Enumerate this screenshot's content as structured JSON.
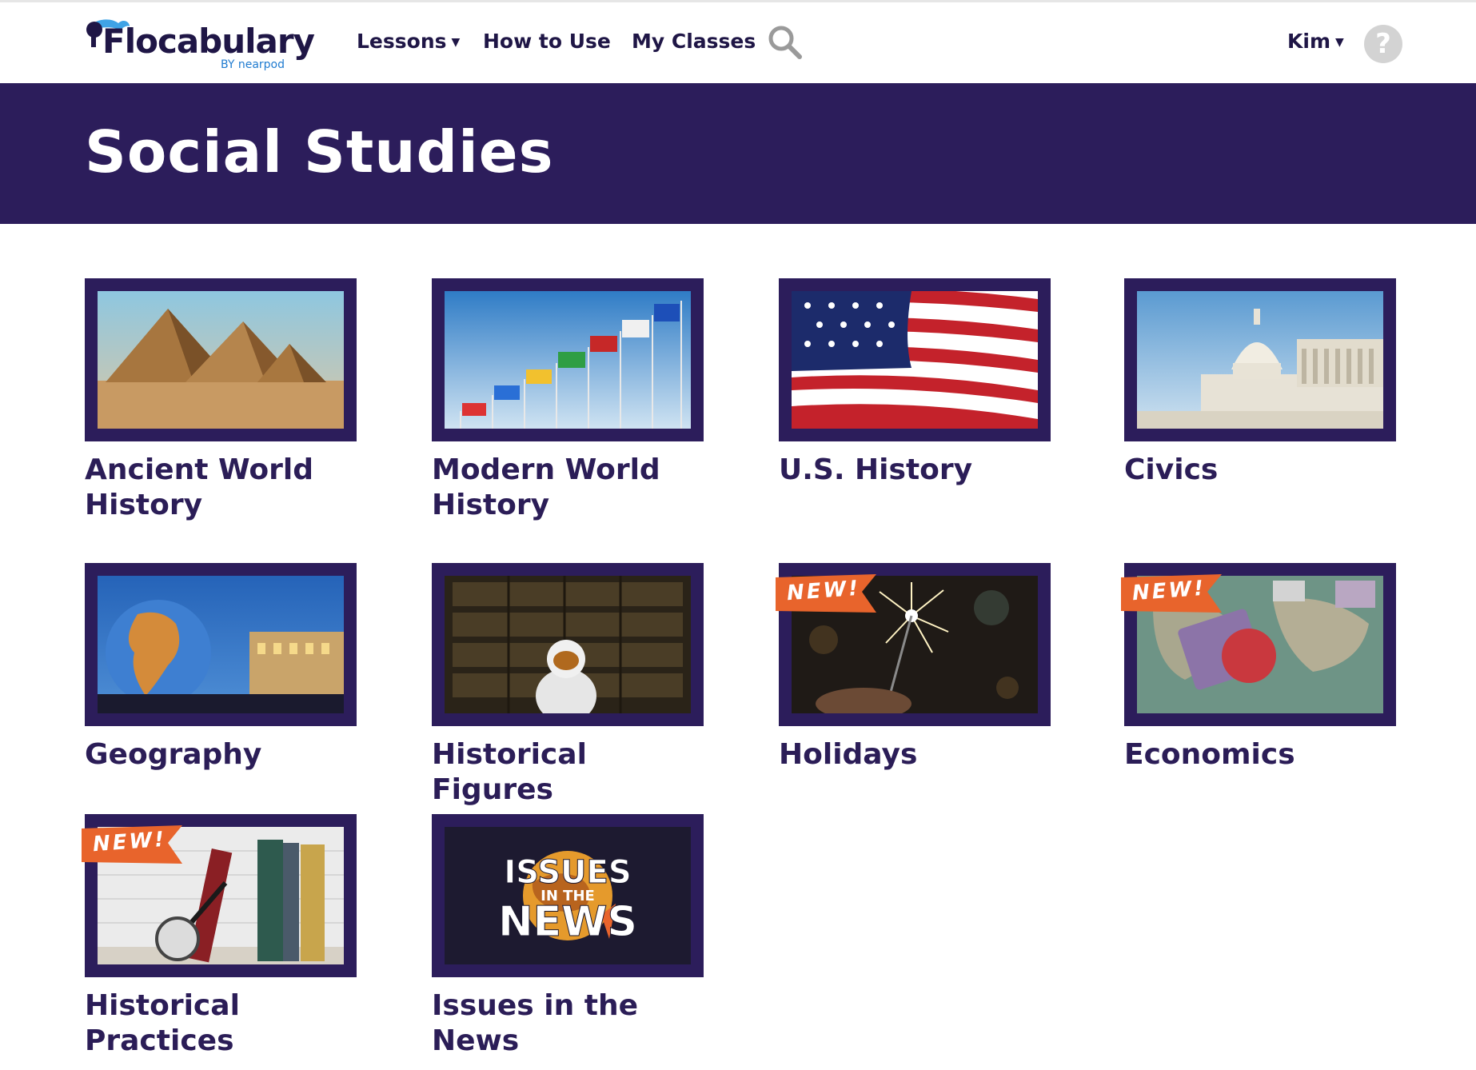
{
  "header": {
    "logo_text": "Flocabulary",
    "logo_sub": "BY nearpod",
    "nav": {
      "lessons": "Lessons",
      "how_to_use": "How to Use",
      "my_classes": "My Classes",
      "user": "Kim",
      "help": "?"
    },
    "icons": {
      "search": "search-icon",
      "help": "help-icon",
      "caret": "chevron-down-icon"
    }
  },
  "page": {
    "title": "Social Studies"
  },
  "badge_text": "NEW!",
  "colors": {
    "primary": "#2c1d5b",
    "badge": "#e8642c",
    "title_text": "#2b1d57"
  },
  "cards": [
    {
      "title": "Ancient World History",
      "new": false
    },
    {
      "title": "Modern World History",
      "new": false
    },
    {
      "title": "U.S. History",
      "new": false
    },
    {
      "title": "Civics",
      "new": false
    },
    {
      "title": "Geography",
      "new": false
    },
    {
      "title": "Historical Figures",
      "new": false
    },
    {
      "title": "Holidays",
      "new": true
    },
    {
      "title": "Economics",
      "new": true
    },
    {
      "title": "Historical Practices",
      "new": true
    },
    {
      "title": "Issues in the News",
      "new": false
    }
  ],
  "issues_logo": {
    "line1": "ISSUES",
    "line2": "IN THE",
    "line3": "NEWS"
  }
}
